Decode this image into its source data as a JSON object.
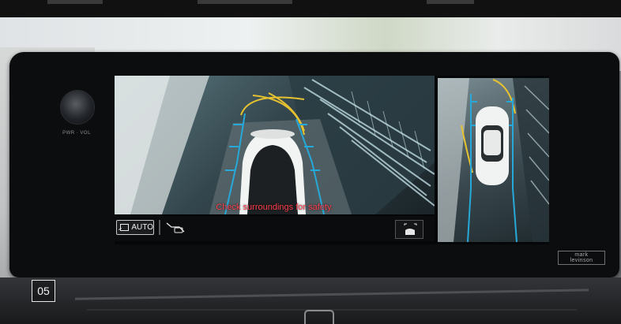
{
  "panel": {
    "knob_label": "PWR · VOL",
    "brand_line1": "mark",
    "brand_line2": "levinson"
  },
  "display": {
    "warning_text": "Check surroundings for safety.",
    "auto_label": "AUTO"
  },
  "slide_number": "05",
  "colors": {
    "warning": "#ff3e4d",
    "guide_yellow": "#e6c230",
    "guide_blue": "#26a9d8"
  }
}
